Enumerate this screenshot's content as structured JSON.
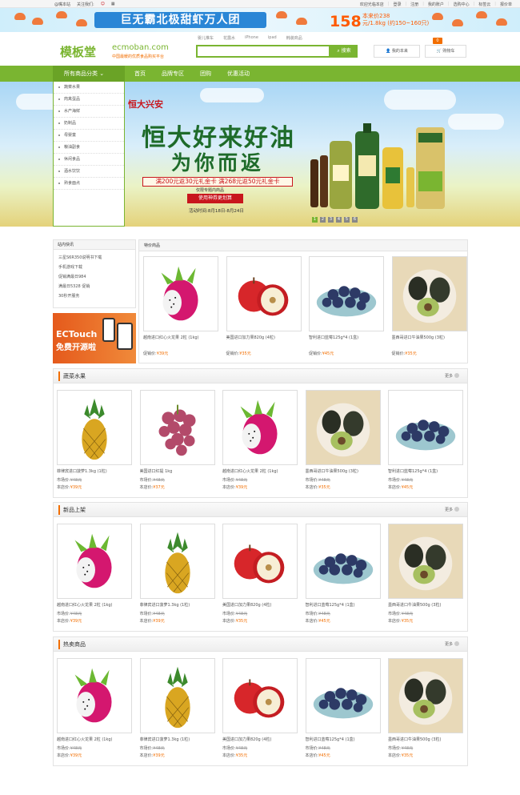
{
  "topbar": {
    "left": [
      "@嘴本站",
      "关注我们:"
    ],
    "right": [
      "欢迎光临本店",
      "登录",
      "注册",
      "我的账户",
      "选购中心",
      "标签云",
      "报价单"
    ]
  },
  "promo": {
    "title": "巨无霸北极甜虾万人团",
    "price": "158",
    "line1": "本来价238",
    "line2": "元/1.8kg (约150~160只)"
  },
  "header": {
    "logo": "模板堂",
    "logo_en": "ecmoban.com",
    "logo_sub": "中国最暖的优质食品购买平台",
    "hot": [
      "婴儿推车",
      "花露水",
      "iPhone",
      "ipad",
      "韩装商品"
    ],
    "search_placeholder": "",
    "search_btn": "搜索",
    "mine": "我的本来",
    "cart": "购物车",
    "cart_count": "0"
  },
  "nav": {
    "category": "所有商品分类",
    "links": [
      "首页",
      "品牌专区",
      "团购",
      "优惠活动"
    ]
  },
  "categories": [
    "蔬菜水果",
    "肉禽蛋品",
    "水产海鲜",
    "奶制品",
    "母婴童",
    "粮油副食",
    "休闲食品",
    "酒水饮饮",
    "熟食面点"
  ],
  "banner": {
    "brand": "恒大兴安",
    "slogan1": "恒大好来好油",
    "slogan2": "为你而返",
    "offer": "满200元返30元礼金卡 满268元返50元礼金卡",
    "offer2": "仅限专题内商品",
    "btn": "使用神券更划算",
    "date": "活动时间:8月18日-8月24日",
    "dots": [
      "1",
      "2",
      "3",
      "4",
      "5",
      "6"
    ]
  },
  "quick": {
    "title": "站内快讯",
    "items": [
      "三星S6R350说明书下载",
      "手机游戏下载",
      "促销满最日984",
      "满最日5328 促销",
      "30秒开服务"
    ]
  },
  "ad": {
    "t1": "ECTouch",
    "t2": "免费开源啦"
  },
  "special": {
    "title": "特价商品",
    "products": [
      {
        "img": "dragonfruit",
        "name": "越南进口红心火龙果 2粒 (1kg)",
        "price_label": "促销价:",
        "price": "¥39元"
      },
      {
        "img": "apple",
        "name": "美国进口加力果820g (4粒)",
        "price_label": "促销价:",
        "price": "¥35元"
      },
      {
        "img": "blueberry",
        "name": "智利进口蓝莓125g*4 (1盒)",
        "price_label": "促销价:",
        "price": "¥45元"
      },
      {
        "img": "avocado",
        "name": "墨西哥进口牛油果500g (3粒)",
        "price_label": "促销价:",
        "price": "¥35元"
      }
    ]
  },
  "sections": [
    {
      "title": "蔬菜水果",
      "more": "更多",
      "products": [
        {
          "img": "pineapple",
          "name": "菲律宾进口菠萝1.3kg (1粒)",
          "market": "¥48元",
          "price": "¥39元"
        },
        {
          "img": "grape",
          "name": "美国进口红提 1kg",
          "market": "¥48元",
          "price": "¥37元"
        },
        {
          "img": "dragonfruit",
          "name": "越南进口红心火龙果 2粒 (1kg)",
          "market": "¥48元",
          "price": "¥39元"
        },
        {
          "img": "avocado",
          "name": "墨西哥进口牛油果500g (3粒)",
          "market": "¥48元",
          "price": "¥35元"
        },
        {
          "img": "blueberry",
          "name": "智利进口蓝莓125g*4 (1盒)",
          "market": "¥48元",
          "price": "¥45元"
        }
      ]
    },
    {
      "title": "新品上架",
      "more": "更多",
      "products": [
        {
          "img": "dragonfruit",
          "name": "越南进口红心火龙果 2粒 (1kg)",
          "market": "¥48元",
          "price": "¥39元"
        },
        {
          "img": "pineapple",
          "name": "菲律宾进口菠萝1.3kg (1粒)",
          "market": "¥48元",
          "price": "¥39元"
        },
        {
          "img": "apple",
          "name": "美国进口加力果820g (4粒)",
          "market": "¥48元",
          "price": "¥35元"
        },
        {
          "img": "blueberry",
          "name": "智利进口蓝莓125g*4 (1盒)",
          "market": "¥48元",
          "price": "¥45元"
        },
        {
          "img": "avocado",
          "name": "墨西哥进口牛油果500g (3粒)",
          "market": "¥48元",
          "price": "¥35元"
        }
      ]
    },
    {
      "title": "热卖商品",
      "more": "更多",
      "products": [
        {
          "img": "dragonfruit",
          "name": "越南进口红心火龙果 2粒 (1kg)",
          "market": "¥48元",
          "price": "¥39元"
        },
        {
          "img": "pineapple",
          "name": "菲律宾进口菠萝1.3kg (1粒)",
          "market": "¥48元",
          "price": "¥39元"
        },
        {
          "img": "apple",
          "name": "美国进口加力果820g (4粒)",
          "market": "¥48元",
          "price": "¥35元"
        },
        {
          "img": "blueberry",
          "name": "智利进口蓝莓125g*4 (1盒)",
          "market": "¥48元",
          "price": "¥45元"
        },
        {
          "img": "avocado",
          "name": "墨西哥进口牛油果500g (3粒)",
          "market": "¥48元",
          "price": "¥35元"
        }
      ]
    }
  ],
  "labels": {
    "market": "市场价:",
    "ours": "本店价:"
  }
}
